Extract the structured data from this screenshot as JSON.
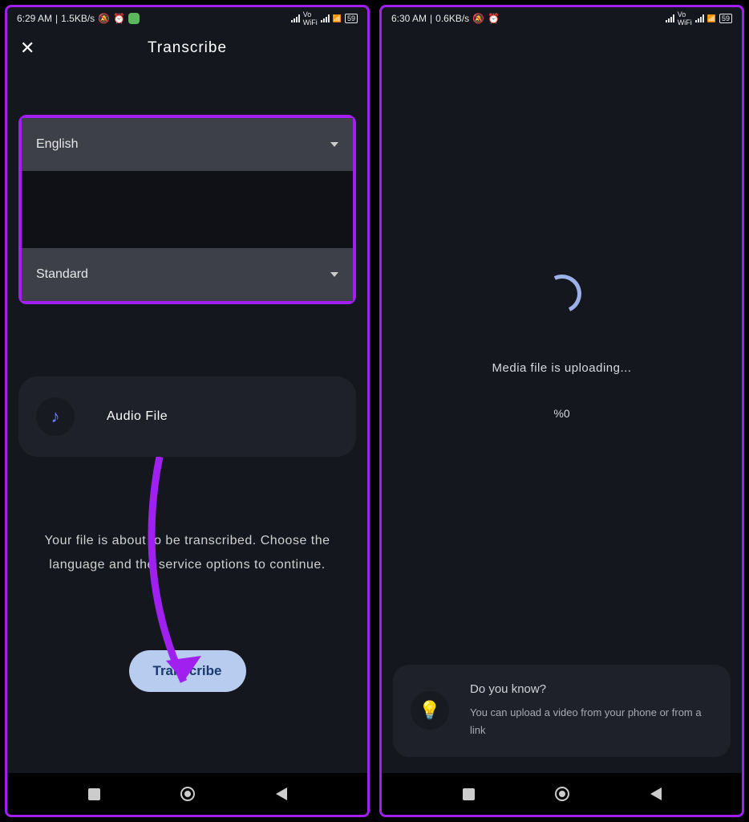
{
  "left": {
    "status": {
      "time": "6:29 AM",
      "speed": "1.5KB/s",
      "battery": "59"
    },
    "header": {
      "title": "Transcribe"
    },
    "dropdowns": {
      "language": "English",
      "service": "Standard"
    },
    "audio_card": {
      "label": "Audio File"
    },
    "hint": "Your file is about to be transcribed. Choose the language and the service options to continue.",
    "button": "Transcribe"
  },
  "right": {
    "status": {
      "time": "6:30 AM",
      "speed": "0.6KB/s",
      "battery": "59"
    },
    "uploading": {
      "text": "Media file is uploading...",
      "percent": "%0"
    },
    "tip": {
      "title": "Do you know?",
      "body": "You can upload a video from your phone or from a link"
    }
  }
}
